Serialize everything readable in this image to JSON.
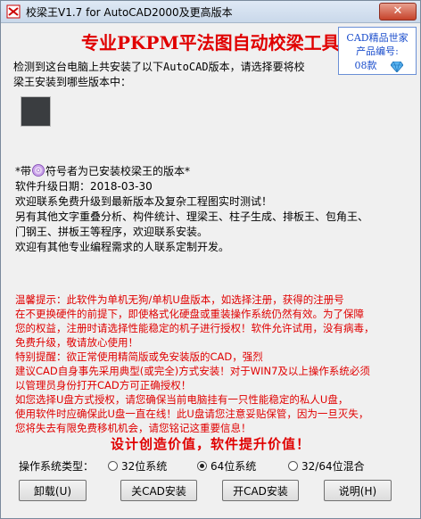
{
  "window": {
    "title": "校梁王V1.7 for AutoCAD2000及更高版本",
    "close_glyph": "✕"
  },
  "header": {
    "headline": "专业PKPM平法图自动校梁工具",
    "info_box": [
      "CAD精品世家",
      "产品编号:",
      "08款"
    ]
  },
  "intro": {
    "line1": "检测到这台电脑上共安装了以下AutoCAD版本，请选择要将校",
    "line2": "梁王安装到哪些版本中："
  },
  "info": {
    "legend_prefix": "*带",
    "legend_suffix": "符号者为已安装校梁王的版本*",
    "lines": [
      "软件升级日期：2018-03-30",
      "欢迎联系免费升级到最新版本及复杂工程图实时测试！",
      "另有其他文字重叠分析、构件统计、理梁王、柱子生成、排板王、包角王、",
      "门钢王、拼板王等程序，欢迎联系安装。",
      "欢迎有其他专业编程需求的人联系定制开发。"
    ]
  },
  "notice": {
    "lines": [
      "    温馨提示：此软件为单机无狗/单机U盘版本，如选择注册，获得的注册号",
      "在不更换硬件的前提下，即使格式化硬盘或重装操作系统仍然有效。为了保障",
      "您的权益，注册时请选择性能稳定的机子进行授权！软件允许试用，没有病毒，",
      "免费升级，敬请放心使用！",
      "    特别提醒：欲正常使用精简版或免安装版的CAD，强烈",
      "建议CAD自身事先采用典型(或完全)方式安装！对于WIN7及以上操作系统必须",
      "以管理员身份打开CAD方可正确授权！",
      "    如您选择U盘方式授权，请您确保当前电脑挂有一只性能稳定的私人U盘，",
      "使用软件时应确保此U盘一直在线！此U盘请您注意妥贴保管，因为一旦灭失，",
      "您将失去有限免费移机机会，请您铭记这重要信息！"
    ]
  },
  "slogan": "设计创造价值，软件提升价值！",
  "os": {
    "label": "操作系统类型：",
    "options": [
      "32位系统",
      "64位系统",
      "32/64位混合"
    ],
    "selected": "64位系统"
  },
  "buttons": {
    "uninstall": "卸载(U)",
    "close_cad_install": "关CAD安装",
    "open_cad_install": "开CAD安装",
    "help": "说明(H)"
  },
  "colors": {
    "headline": "#e00000",
    "notice": "#e00000",
    "info_box_text": "#1a4dcc",
    "version_square": "#3a3d40"
  }
}
